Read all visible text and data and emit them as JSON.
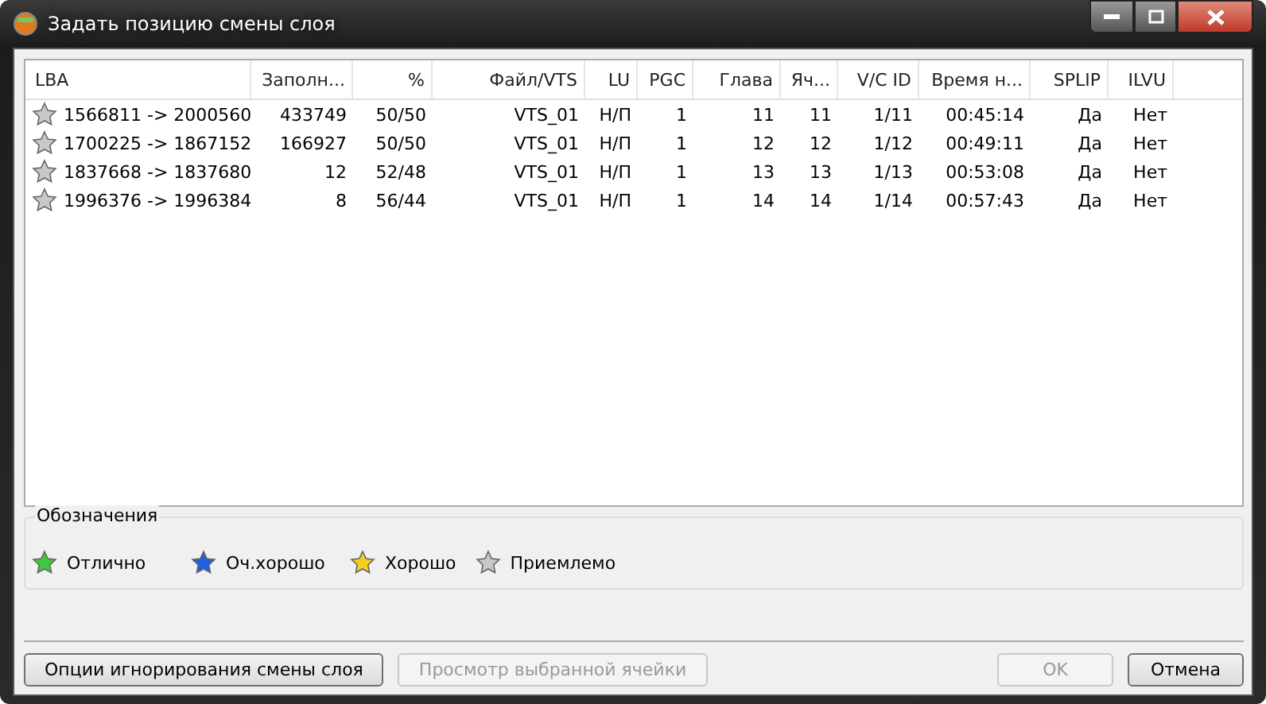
{
  "window": {
    "title": "Задать позицию смены слоя"
  },
  "table": {
    "columns": [
      "LBA",
      "Заполн...",
      "%",
      "Файл/VTS",
      "LU",
      "PGC",
      "Глава",
      "Яч...",
      "V/C ID",
      "Время н...",
      "SPLIP",
      "ILVU"
    ],
    "rows": [
      {
        "color": "#c8c8c8",
        "cells": [
          "1566811 -> 2000560",
          "433749",
          "50/50",
          "VTS_01",
          "Н/П",
          "1",
          "11",
          "11",
          "1/11",
          "00:45:14",
          "Да",
          "Нет"
        ]
      },
      {
        "color": "#c8c8c8",
        "cells": [
          "1700225 -> 1867152",
          "166927",
          "50/50",
          "VTS_01",
          "Н/П",
          "1",
          "12",
          "12",
          "1/12",
          "00:49:11",
          "Да",
          "Нет"
        ]
      },
      {
        "color": "#c8c8c8",
        "cells": [
          "1837668 -> 1837680",
          "12",
          "52/48",
          "VTS_01",
          "Н/П",
          "1",
          "13",
          "13",
          "1/13",
          "00:53:08",
          "Да",
          "Нет"
        ]
      },
      {
        "color": "#c8c8c8",
        "cells": [
          "1996376 -> 1996384",
          "8",
          "56/44",
          "VTS_01",
          "Н/П",
          "1",
          "14",
          "14",
          "1/14",
          "00:57:43",
          "Да",
          "Нет"
        ]
      }
    ]
  },
  "legend": {
    "title": "Обозначения",
    "items": [
      {
        "label": "Отлично",
        "color": "#3fc83f"
      },
      {
        "label": "Оч.хорошо",
        "color": "#1f5fe0"
      },
      {
        "label": "Хорошо",
        "color": "#f0d020"
      },
      {
        "label": "Приемлемо",
        "color": "#c8c8c8"
      }
    ]
  },
  "buttons_left": [
    {
      "label": "Опции игнорирования смены слоя",
      "disabled": false
    },
    {
      "label": "Просмотр выбранной ячейки",
      "disabled": true
    }
  ],
  "buttons_right": [
    {
      "label": "OK",
      "disabled": true
    },
    {
      "label": "Отмена",
      "disabled": false
    }
  ]
}
